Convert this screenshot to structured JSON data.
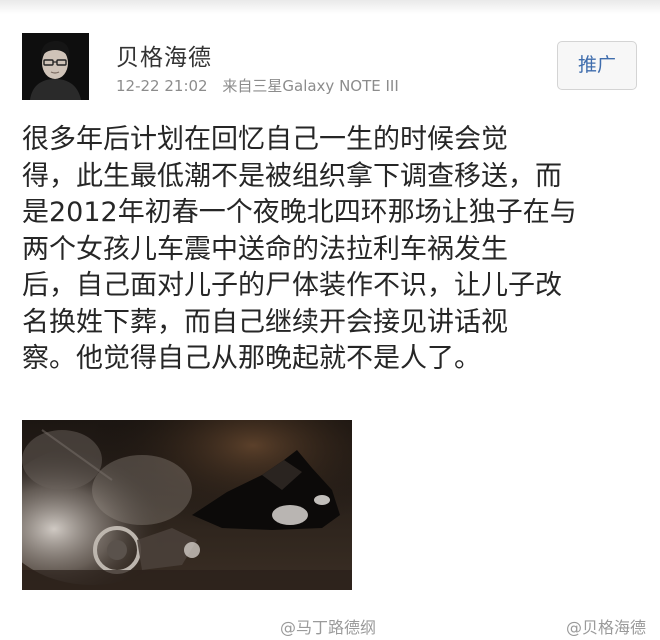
{
  "post": {
    "author": "贝格海德",
    "time": "12-22 21:02",
    "source": "来自三星Galaxy NOTE III",
    "promote_label": "推广",
    "text_lines": [
      "很多年后计划在回忆自己一生的时候会觉",
      "得，此生最低潮不是被组织拿下调查移送，而",
      "是2012年初春一个夜晚北四环那场让独子在与",
      "两个女孩儿车震中送命的法拉利车祸发生",
      "后，自己面对儿子的尸体装作不识，让儿子改",
      "名换姓下葬，而自己继续开会接见讲话视",
      "察。他觉得自己从那晚起就不是人了。"
    ]
  },
  "watermarks": {
    "left": "@马丁路德纲",
    "right": "@贝格海德"
  },
  "colors": {
    "link_blue": "#3f6dad",
    "text": "#262626",
    "meta_gray": "#8c8c8c"
  }
}
